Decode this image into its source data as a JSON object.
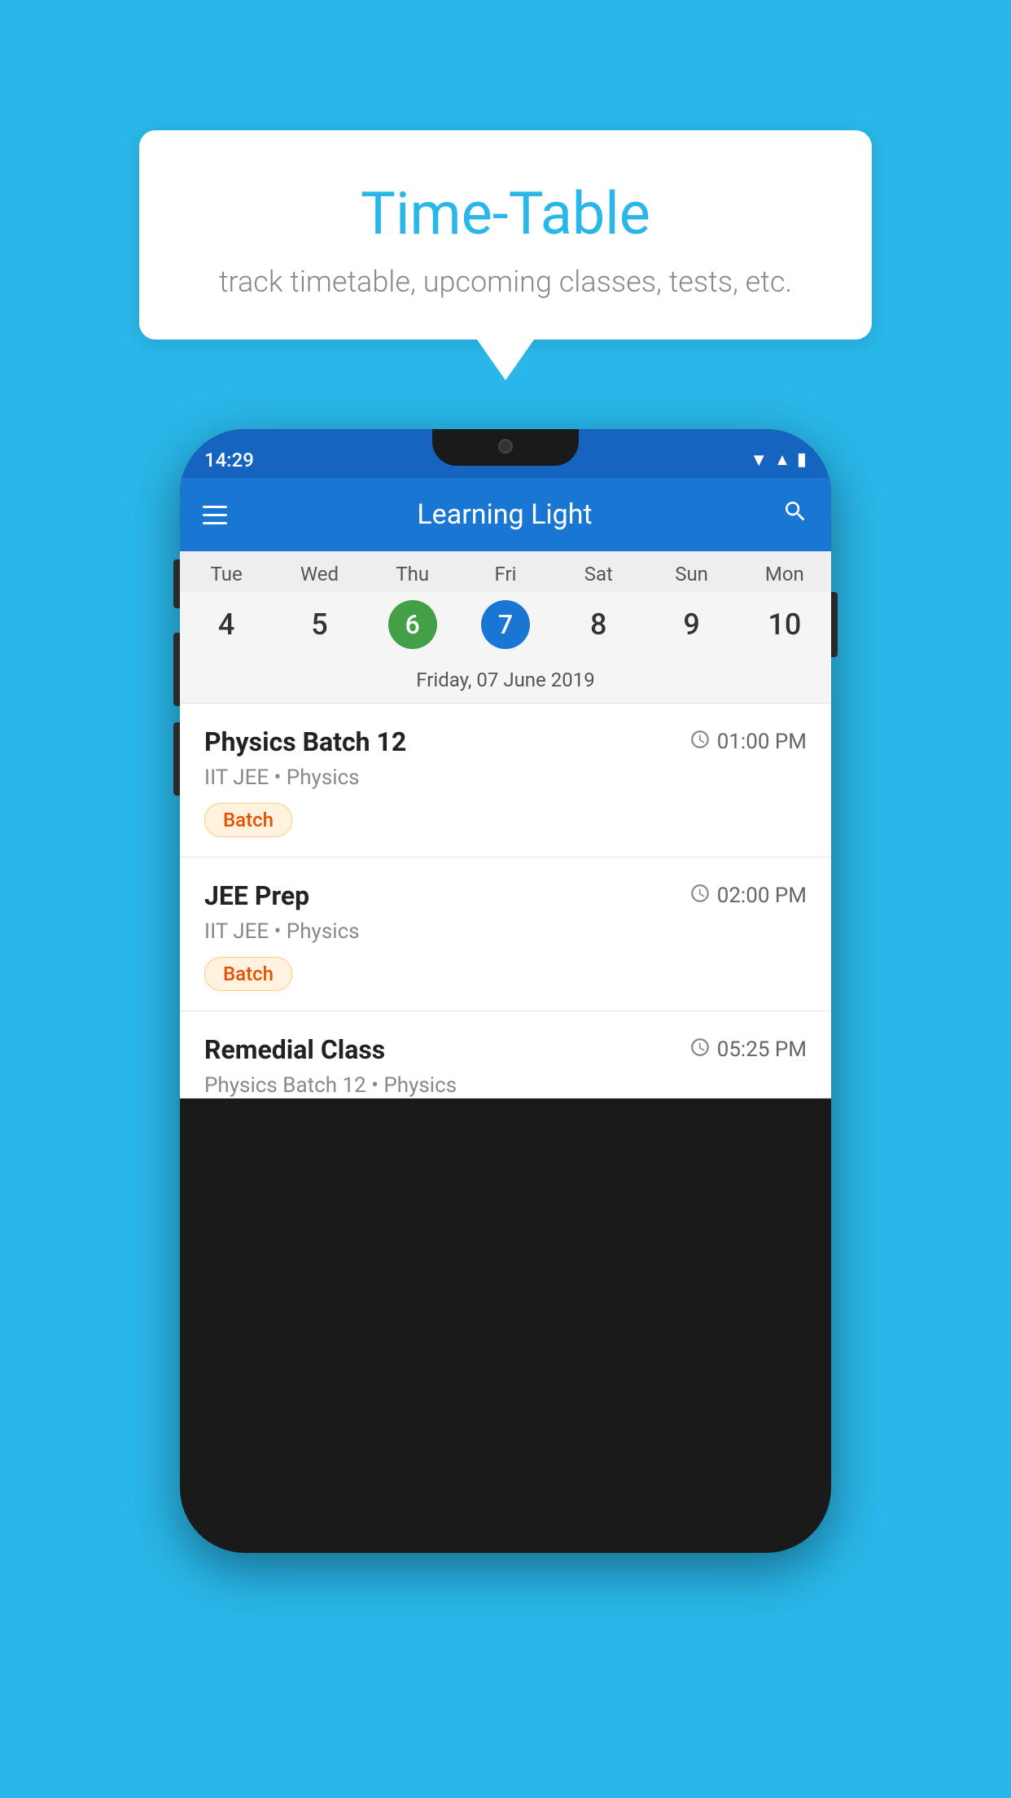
{
  "background_color": "#29b6e8",
  "speech_bubble": {
    "title": "Time-Table",
    "subtitle": "track timetable, upcoming classes, tests, etc."
  },
  "phone": {
    "status_bar": {
      "time": "14:29"
    },
    "app_bar": {
      "title": "Learning Light"
    },
    "calendar": {
      "day_labels": [
        "Tue",
        "Wed",
        "Thu",
        "Fri",
        "Sat",
        "Sun",
        "Mon"
      ],
      "day_numbers": [
        "4",
        "5",
        "6",
        "7",
        "8",
        "9",
        "10"
      ],
      "today_index": 2,
      "selected_index": 3,
      "selected_date_label": "Friday, 07 June 2019"
    },
    "schedule_items": [
      {
        "title": "Physics Batch 12",
        "time": "01:00 PM",
        "subtitle": "IIT JEE • Physics",
        "tag": "Batch"
      },
      {
        "title": "JEE Prep",
        "time": "02:00 PM",
        "subtitle": "IIT JEE • Physics",
        "tag": "Batch"
      },
      {
        "title": "Remedial Class",
        "time": "05:25 PM",
        "subtitle": "Physics Batch 12 • Physics",
        "tag": ""
      }
    ]
  }
}
